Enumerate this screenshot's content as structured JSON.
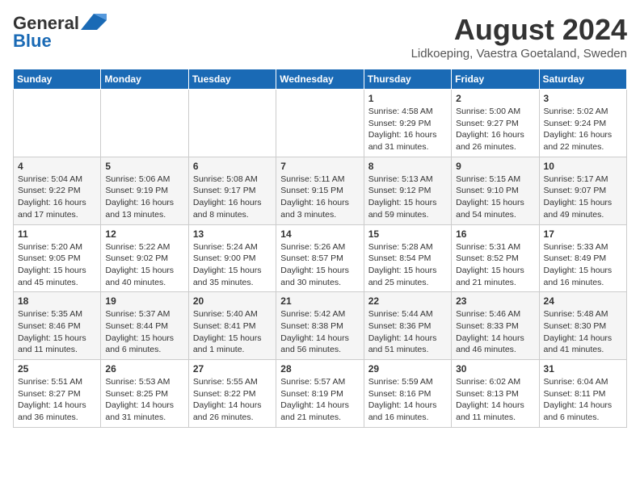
{
  "header": {
    "logo_general": "General",
    "logo_blue": "Blue",
    "title": "August 2024",
    "subtitle": "Lidkoeping, Vaestra Goetaland, Sweden"
  },
  "weekdays": [
    "Sunday",
    "Monday",
    "Tuesday",
    "Wednesday",
    "Thursday",
    "Friday",
    "Saturday"
  ],
  "weeks": [
    [
      {
        "day": "",
        "info": ""
      },
      {
        "day": "",
        "info": ""
      },
      {
        "day": "",
        "info": ""
      },
      {
        "day": "",
        "info": ""
      },
      {
        "day": "1",
        "info": "Sunrise: 4:58 AM\nSunset: 9:29 PM\nDaylight: 16 hours\nand 31 minutes."
      },
      {
        "day": "2",
        "info": "Sunrise: 5:00 AM\nSunset: 9:27 PM\nDaylight: 16 hours\nand 26 minutes."
      },
      {
        "day": "3",
        "info": "Sunrise: 5:02 AM\nSunset: 9:24 PM\nDaylight: 16 hours\nand 22 minutes."
      }
    ],
    [
      {
        "day": "4",
        "info": "Sunrise: 5:04 AM\nSunset: 9:22 PM\nDaylight: 16 hours\nand 17 minutes."
      },
      {
        "day": "5",
        "info": "Sunrise: 5:06 AM\nSunset: 9:19 PM\nDaylight: 16 hours\nand 13 minutes."
      },
      {
        "day": "6",
        "info": "Sunrise: 5:08 AM\nSunset: 9:17 PM\nDaylight: 16 hours\nand 8 minutes."
      },
      {
        "day": "7",
        "info": "Sunrise: 5:11 AM\nSunset: 9:15 PM\nDaylight: 16 hours\nand 3 minutes."
      },
      {
        "day": "8",
        "info": "Sunrise: 5:13 AM\nSunset: 9:12 PM\nDaylight: 15 hours\nand 59 minutes."
      },
      {
        "day": "9",
        "info": "Sunrise: 5:15 AM\nSunset: 9:10 PM\nDaylight: 15 hours\nand 54 minutes."
      },
      {
        "day": "10",
        "info": "Sunrise: 5:17 AM\nSunset: 9:07 PM\nDaylight: 15 hours\nand 49 minutes."
      }
    ],
    [
      {
        "day": "11",
        "info": "Sunrise: 5:20 AM\nSunset: 9:05 PM\nDaylight: 15 hours\nand 45 minutes."
      },
      {
        "day": "12",
        "info": "Sunrise: 5:22 AM\nSunset: 9:02 PM\nDaylight: 15 hours\nand 40 minutes."
      },
      {
        "day": "13",
        "info": "Sunrise: 5:24 AM\nSunset: 9:00 PM\nDaylight: 15 hours\nand 35 minutes."
      },
      {
        "day": "14",
        "info": "Sunrise: 5:26 AM\nSunset: 8:57 PM\nDaylight: 15 hours\nand 30 minutes."
      },
      {
        "day": "15",
        "info": "Sunrise: 5:28 AM\nSunset: 8:54 PM\nDaylight: 15 hours\nand 25 minutes."
      },
      {
        "day": "16",
        "info": "Sunrise: 5:31 AM\nSunset: 8:52 PM\nDaylight: 15 hours\nand 21 minutes."
      },
      {
        "day": "17",
        "info": "Sunrise: 5:33 AM\nSunset: 8:49 PM\nDaylight: 15 hours\nand 16 minutes."
      }
    ],
    [
      {
        "day": "18",
        "info": "Sunrise: 5:35 AM\nSunset: 8:46 PM\nDaylight: 15 hours\nand 11 minutes."
      },
      {
        "day": "19",
        "info": "Sunrise: 5:37 AM\nSunset: 8:44 PM\nDaylight: 15 hours\nand 6 minutes."
      },
      {
        "day": "20",
        "info": "Sunrise: 5:40 AM\nSunset: 8:41 PM\nDaylight: 15 hours\nand 1 minute."
      },
      {
        "day": "21",
        "info": "Sunrise: 5:42 AM\nSunset: 8:38 PM\nDaylight: 14 hours\nand 56 minutes."
      },
      {
        "day": "22",
        "info": "Sunrise: 5:44 AM\nSunset: 8:36 PM\nDaylight: 14 hours\nand 51 minutes."
      },
      {
        "day": "23",
        "info": "Sunrise: 5:46 AM\nSunset: 8:33 PM\nDaylight: 14 hours\nand 46 minutes."
      },
      {
        "day": "24",
        "info": "Sunrise: 5:48 AM\nSunset: 8:30 PM\nDaylight: 14 hours\nand 41 minutes."
      }
    ],
    [
      {
        "day": "25",
        "info": "Sunrise: 5:51 AM\nSunset: 8:27 PM\nDaylight: 14 hours\nand 36 minutes."
      },
      {
        "day": "26",
        "info": "Sunrise: 5:53 AM\nSunset: 8:25 PM\nDaylight: 14 hours\nand 31 minutes."
      },
      {
        "day": "27",
        "info": "Sunrise: 5:55 AM\nSunset: 8:22 PM\nDaylight: 14 hours\nand 26 minutes."
      },
      {
        "day": "28",
        "info": "Sunrise: 5:57 AM\nSunset: 8:19 PM\nDaylight: 14 hours\nand 21 minutes."
      },
      {
        "day": "29",
        "info": "Sunrise: 5:59 AM\nSunset: 8:16 PM\nDaylight: 14 hours\nand 16 minutes."
      },
      {
        "day": "30",
        "info": "Sunrise: 6:02 AM\nSunset: 8:13 PM\nDaylight: 14 hours\nand 11 minutes."
      },
      {
        "day": "31",
        "info": "Sunrise: 6:04 AM\nSunset: 8:11 PM\nDaylight: 14 hours\nand 6 minutes."
      }
    ]
  ]
}
